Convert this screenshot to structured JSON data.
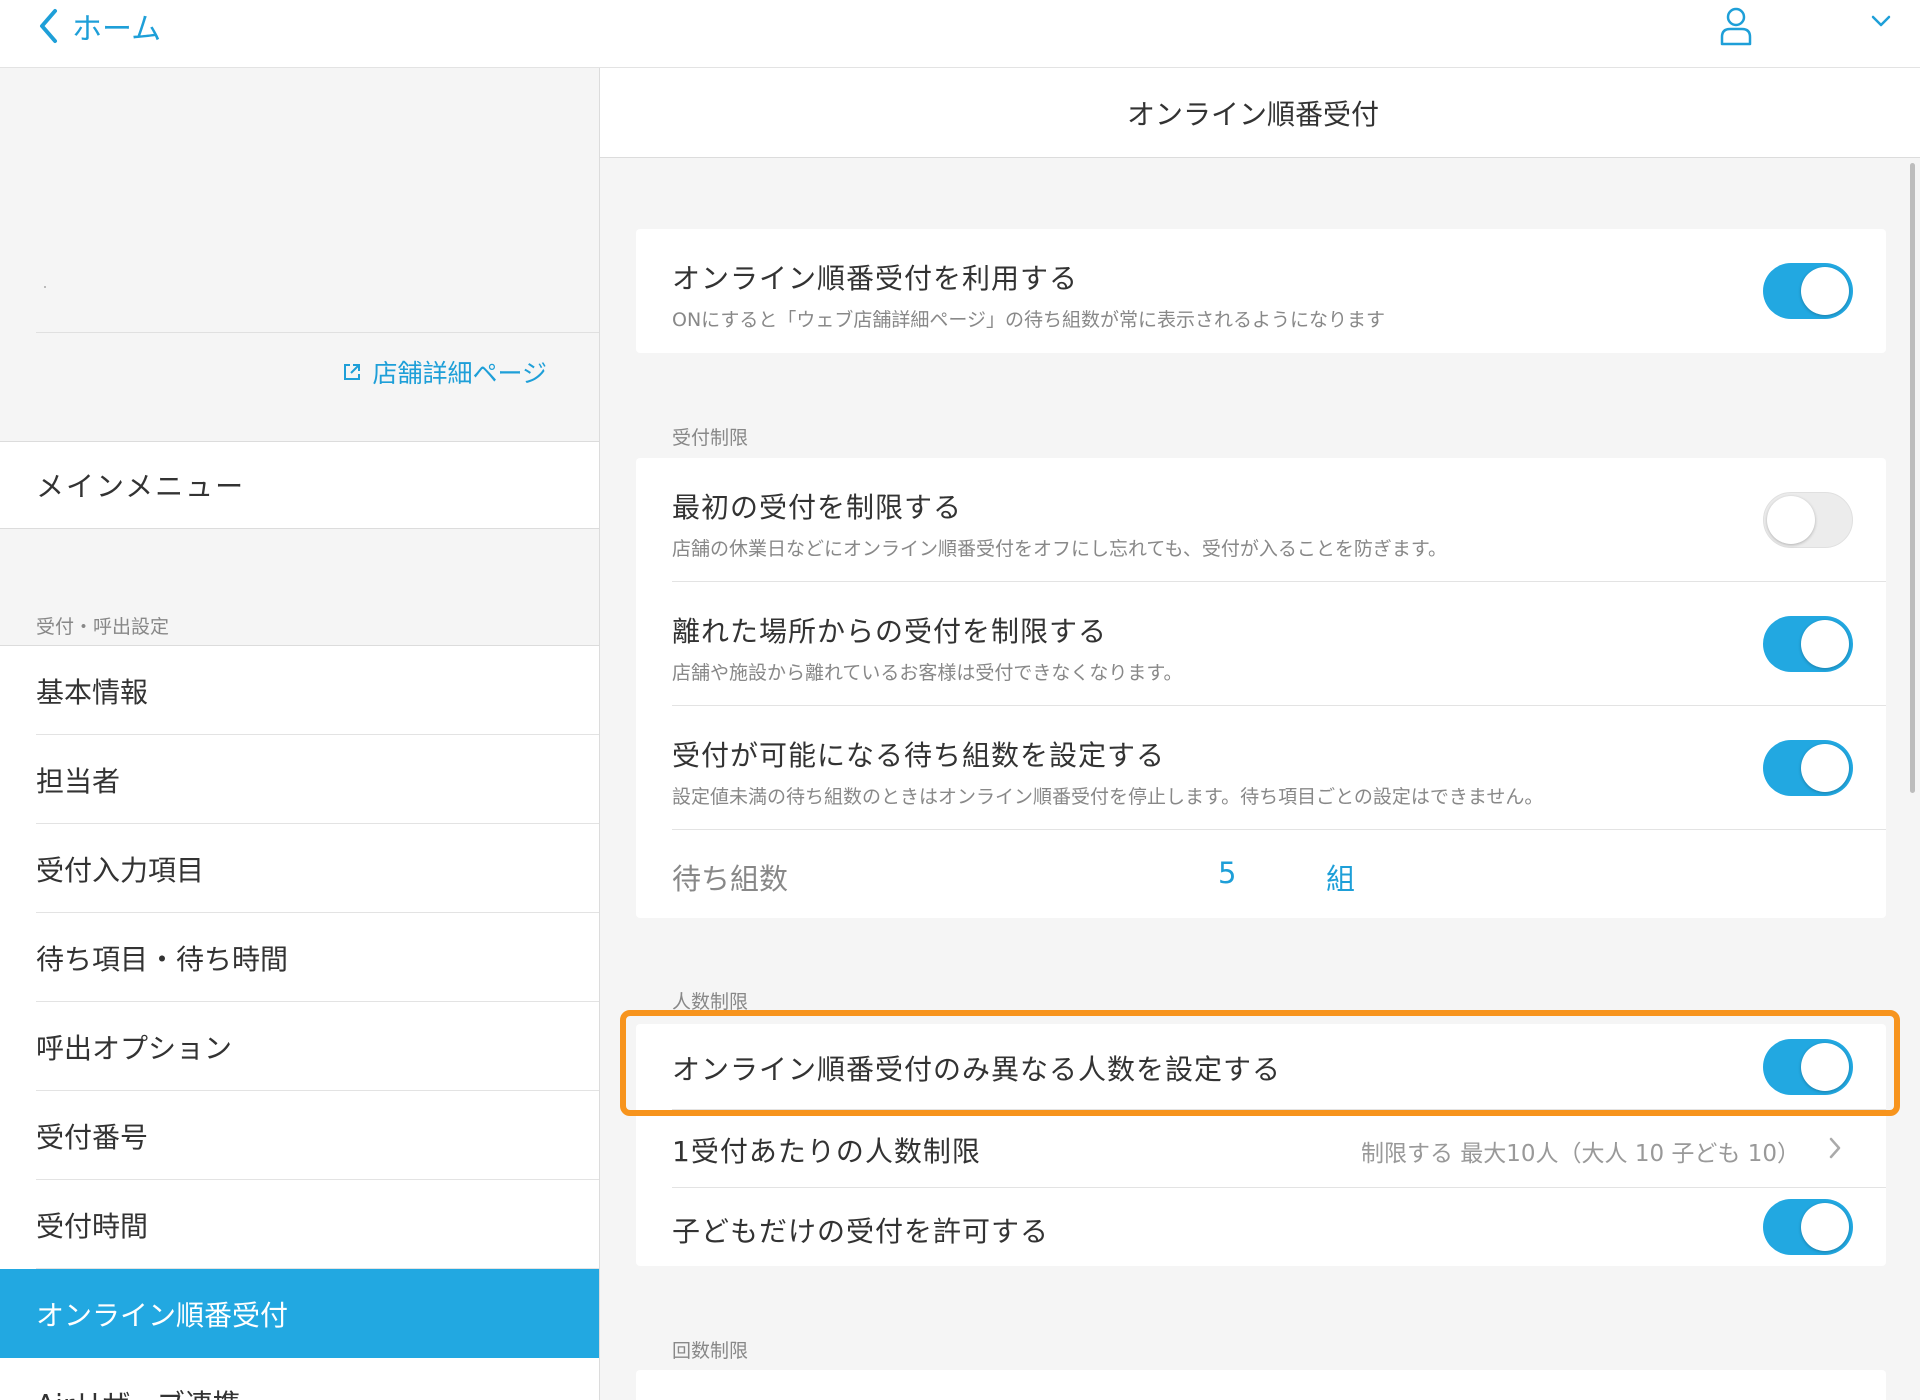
{
  "topbar": {
    "back_label": "ホーム"
  },
  "sidebar": {
    "shop_link": "店舗詳細ページ",
    "main_menu": "メインメニュー",
    "section_title": "受付・呼出設定",
    "items": [
      {
        "label": "基本情報"
      },
      {
        "label": "担当者"
      },
      {
        "label": "受付入力項目"
      },
      {
        "label": "待ち項目・待ち時間"
      },
      {
        "label": "呼出オプション"
      },
      {
        "label": "受付番号"
      },
      {
        "label": "受付時間"
      },
      {
        "label": "オンライン順番受付"
      },
      {
        "label": "Airリザーブ連携"
      }
    ]
  },
  "main": {
    "title": "オンライン順番受付",
    "use": {
      "title": "オンライン順番受付を利用する",
      "desc": "ONにすると「ウェブ店舗詳細ページ」の待ち組数が常に表示されるようになります",
      "on": true
    },
    "reception_limit": {
      "section": "受付制限",
      "first": {
        "title": "最初の受付を制限する",
        "desc": "店舗の休業日などにオンライン順番受付をオフにし忘れても、受付が入ることを防ぎます。",
        "on": false
      },
      "remote": {
        "title": "離れた場所からの受付を制限する",
        "desc": "店舗や施設から離れているお客様は受付できなくなります。",
        "on": true
      },
      "groups": {
        "title": "受付が可能になる待ち組数を設定する",
        "desc": "設定値未満の待ち組数のときはオンライン順番受付を停止します。待ち項目ごとの設定はできません。",
        "on": true
      },
      "wait": {
        "label": "待ち組数",
        "value": "5",
        "unit": "組"
      }
    },
    "people_limit": {
      "section": "人数制限",
      "different": {
        "title": "オンライン順番受付のみ異なる人数を設定する",
        "on": true
      },
      "per": {
        "title": "1受付あたりの人数制限",
        "value": "制限する 最大10人（大人 10 子ども 10）"
      },
      "children": {
        "title": "子どもだけの受付を許可する",
        "on": true
      }
    },
    "count_limit": {
      "section": "回数制限"
    }
  },
  "colors": {
    "accent": "#22a8e1",
    "highlight": "#f7941d"
  }
}
